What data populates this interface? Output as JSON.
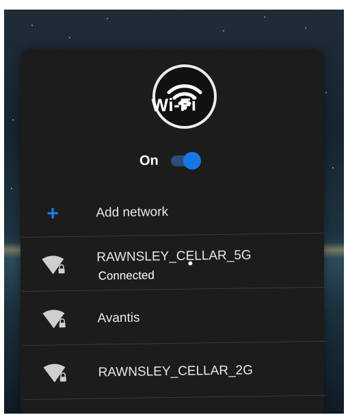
{
  "window": {
    "title": "Wi-Fi"
  },
  "wifi": {
    "toggle_label": "On",
    "toggle_state": "on",
    "accent_color": "#1877e6"
  },
  "add_network": {
    "label": "Add network",
    "icon": "plus-icon"
  },
  "networks": [
    {
      "ssid": "RAWNSLEY_CELLAR_5G",
      "status": "Connected",
      "icon": "wifi-signal-lock-icon"
    },
    {
      "ssid": "Avantis",
      "icon": "wifi-signal-lock-icon"
    },
    {
      "ssid": "RAWNSLEY_CELLAR_2G",
      "icon": "wifi-signal-lock-icon"
    }
  ]
}
